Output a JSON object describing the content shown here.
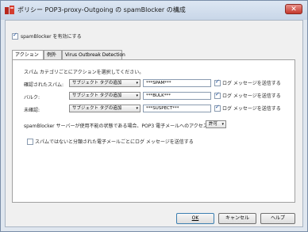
{
  "window": {
    "title": "ポリシー POP3-proxy-Outgoing の spamBlocker の構成",
    "close_label": "✕"
  },
  "enable": {
    "label": "spamBlocker を有効にする",
    "checked": true
  },
  "tabs": [
    {
      "label": "アクション",
      "active": true
    },
    {
      "label": "例外",
      "active": false
    },
    {
      "label": "Virus Outbreak Detection",
      "active": false
    }
  ],
  "instructions": "スパム カテゴリごとにアクションを選択してください。",
  "categories": [
    {
      "label": "確認されたスパム:",
      "action": "サブジェクト タグの追加",
      "tag": "***SPAM***",
      "log_label": "ログ メッセージを送信する",
      "log_checked": true
    },
    {
      "label": "バルク:",
      "action": "サブジェクト タグの追加",
      "tag": "***BULK***",
      "log_label": "ログ メッセージを送信する",
      "log_checked": true
    },
    {
      "label": "未確認:",
      "action": "サブジェクト タグの追加",
      "tag": "***SUSPECT***",
      "log_label": "ログ メッセージを送信する",
      "log_checked": true
    }
  ],
  "unavailable": {
    "label": "spamBlocker サーバーが使用不能の状態である場合、POP3 電子メールへのアクセスは",
    "value": "許可"
  },
  "nonspam_log": {
    "label": "スパムではないと分類された電子メールごとにログ メッセージを送信する",
    "checked": false
  },
  "buttons": {
    "ok": "OK",
    "cancel": "キャンセル",
    "help": "ヘルプ"
  },
  "dropdown_arrow": "▾",
  "colors": {
    "title_bg": "#c8d6e8",
    "close_red": "#c4382c",
    "check_blue": "#1b4f9c"
  }
}
